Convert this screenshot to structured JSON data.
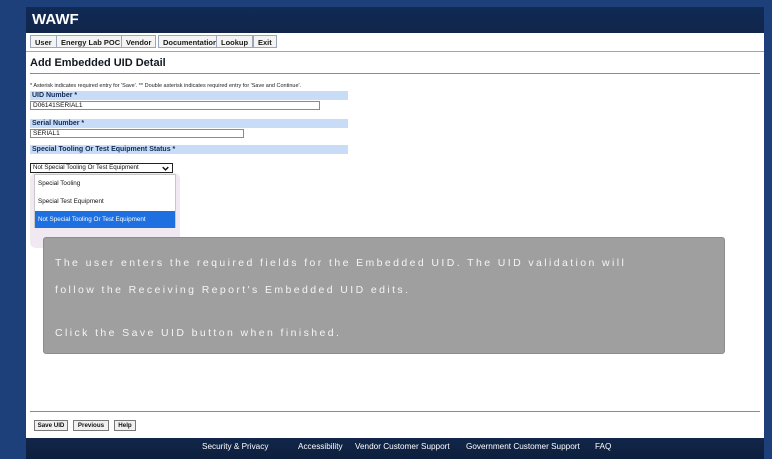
{
  "app_title": "WAWF",
  "menu": [
    "User",
    "Energy Lab POC",
    "Vendor",
    "Documentation",
    "Lookup",
    "Exit"
  ],
  "page_title": "Add Embedded UID Detail",
  "note": "* Asterisk indicates required entry for 'Save'.   ** Double asterisk indicates required entry for 'Save and Continue'.",
  "fields": {
    "uid_number": {
      "label": "UID Number *",
      "value": "D06141SERIAL1"
    },
    "serial_number": {
      "label": "Serial Number *",
      "value": "SERIAL1"
    },
    "status": {
      "label": "Special Tooling Or Test Equipment Status *",
      "selected": "Not Special Tooling Or Test Equipment",
      "options": [
        "Special Tooling",
        "Special Test Equipment",
        "Not Special Tooling Or Test Equipment"
      ]
    }
  },
  "callout": {
    "line1": "The user enters the required fields for the Embedded UID. The UID validation will",
    "line2": "follow the Receiving Report's Embedded UID edits.",
    "line3": "Click the Save UID button when finished."
  },
  "buttons": {
    "save_uid": "Save UID",
    "previous": "Previous",
    "help": "Help"
  },
  "footer": [
    "Security & Privacy",
    "Accessibility",
    "Vendor Customer Support",
    "Government Customer Support",
    "FAQ"
  ]
}
